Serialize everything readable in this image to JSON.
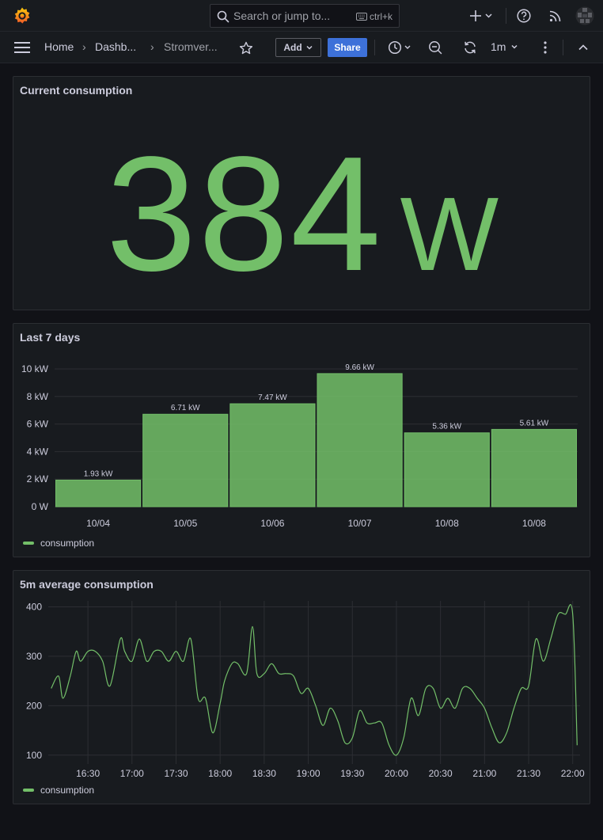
{
  "topbar": {
    "search_placeholder": "Search or jump to...",
    "search_shortcut": "ctrl+k"
  },
  "breadcrumb": {
    "home": "Home",
    "dashboards": "Dashb...",
    "current": "Stromver...",
    "separator": "›"
  },
  "toolbar": {
    "add_label": "Add",
    "share_label": "Share",
    "refresh_interval": "1m"
  },
  "panels": {
    "current": {
      "title": "Current consumption",
      "value": "384",
      "unit": "W",
      "color": "#73bf69"
    },
    "last7": {
      "title": "Last 7 days",
      "legend": "consumption"
    },
    "avg": {
      "title": "5m average consumption",
      "legend": "consumption"
    }
  },
  "chart_data": [
    {
      "type": "bar",
      "title": "Last 7 days",
      "categories": [
        "10/04",
        "10/05",
        "10/06",
        "10/07",
        "10/08",
        "10/08"
      ],
      "values": [
        1.93,
        6.71,
        7.47,
        9.66,
        5.36,
        5.61
      ],
      "data_labels": [
        "1.93 kW",
        "6.71 kW",
        "7.47 kW",
        "9.66 kW",
        "5.36 kW",
        "5.61 kW"
      ],
      "yticks": [
        "0 W",
        "2 kW",
        "4 kW",
        "6 kW",
        "8 kW",
        "10 kW"
      ],
      "ylim": [
        0,
        10
      ],
      "series": [
        {
          "name": "consumption",
          "color": "#73bf69"
        }
      ],
      "legend": "bottom-left",
      "grid": true
    },
    {
      "type": "line",
      "title": "5m average consumption",
      "xticks": [
        "16:30",
        "17:00",
        "17:30",
        "18:00",
        "18:30",
        "19:00",
        "19:30",
        "20:00",
        "20:30",
        "21:00",
        "21:30",
        "22:00"
      ],
      "yticks": [
        "100",
        "200",
        "300",
        "400"
      ],
      "ylim": [
        82,
        412
      ],
      "xlim": [
        "16:03",
        "22:05"
      ],
      "series": [
        {
          "name": "consumption",
          "color": "#73bf69",
          "x": [
            "16:05",
            "16:10",
            "16:13",
            "16:18",
            "16:22",
            "16:25",
            "16:30",
            "16:35",
            "16:40",
            "16:45",
            "16:52",
            "16:55",
            "17:00",
            "17:05",
            "17:10",
            "17:15",
            "17:20",
            "17:25",
            "17:30",
            "17:35",
            "17:40",
            "17:45",
            "17:50",
            "17:55",
            "18:00",
            "18:03",
            "18:08",
            "18:12",
            "18:18",
            "18:22",
            "18:25",
            "18:30",
            "18:35",
            "18:40",
            "18:45",
            "18:50",
            "18:55",
            "19:00",
            "19:05",
            "19:10",
            "19:15",
            "19:20",
            "19:25",
            "19:30",
            "19:35",
            "19:40",
            "19:45",
            "19:50",
            "19:55",
            "20:00",
            "20:05",
            "20:10",
            "20:15",
            "20:20",
            "20:25",
            "20:30",
            "20:35",
            "20:40",
            "20:45",
            "20:50",
            "20:55",
            "21:00",
            "21:05",
            "21:10",
            "21:15",
            "21:20",
            "21:25",
            "21:30",
            "21:35",
            "21:40",
            "21:45",
            "21:50",
            "21:55",
            "22:00",
            "22:03"
          ],
          "y": [
            235,
            260,
            215,
            260,
            310,
            290,
            310,
            310,
            290,
            240,
            335,
            310,
            290,
            335,
            290,
            310,
            310,
            290,
            310,
            290,
            335,
            215,
            215,
            145,
            205,
            250,
            285,
            285,
            265,
            360,
            265,
            265,
            285,
            265,
            265,
            260,
            225,
            235,
            200,
            160,
            195,
            170,
            125,
            135,
            190,
            165,
            165,
            165,
            120,
            100,
            135,
            215,
            180,
            235,
            235,
            195,
            215,
            195,
            235,
            235,
            215,
            195,
            155,
            125,
            145,
            195,
            235,
            240,
            335,
            290,
            335,
            385,
            385,
            385,
            120
          ]
        }
      ],
      "legend": "bottom-left",
      "grid": true
    }
  ]
}
